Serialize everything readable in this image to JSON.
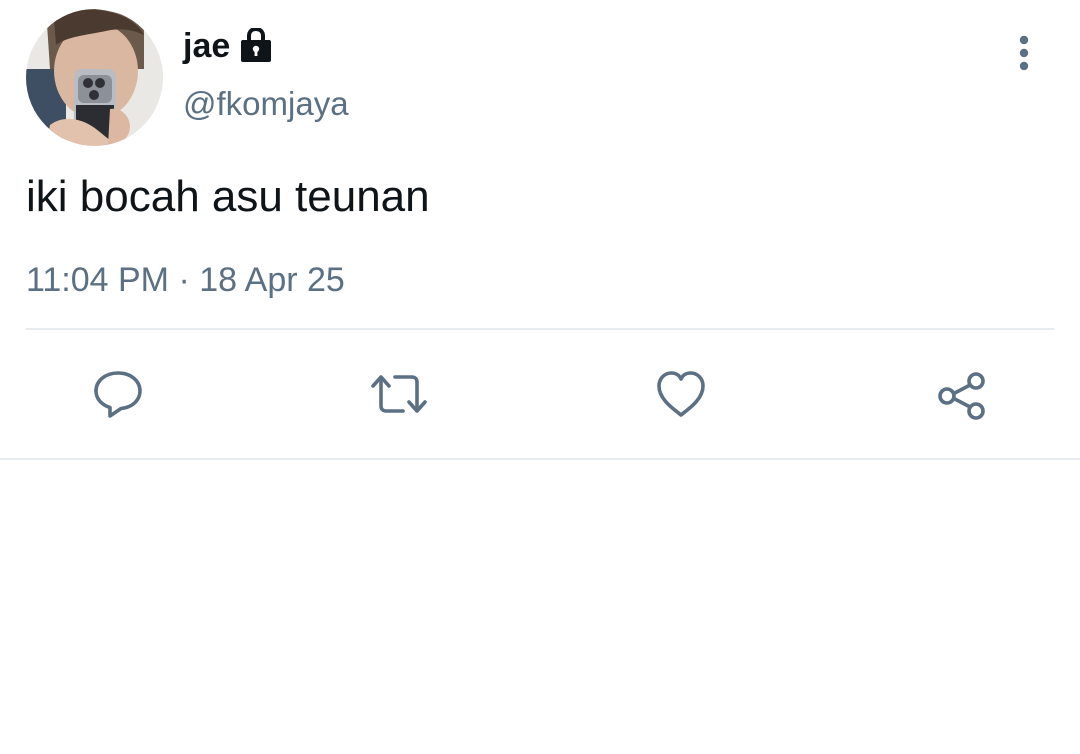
{
  "user": {
    "display_name": "jae",
    "handle": "@fkomjaya",
    "protected": true
  },
  "tweet": {
    "text": "iki bocah asu teunan",
    "time": "11:04 PM",
    "separator": "·",
    "date": "18 Apr 25"
  },
  "icons": {
    "lock": "lock-icon",
    "more": "vertical-dots-icon",
    "reply": "speech-bubble-icon",
    "retweet": "retweet-arrows-icon",
    "like": "heart-icon",
    "share": "share-nodes-icon"
  },
  "colors": {
    "primary_text": "#0f1419",
    "secondary_text": "#5b7083",
    "divider": "#e6ecf0",
    "background": "#ffffff"
  }
}
